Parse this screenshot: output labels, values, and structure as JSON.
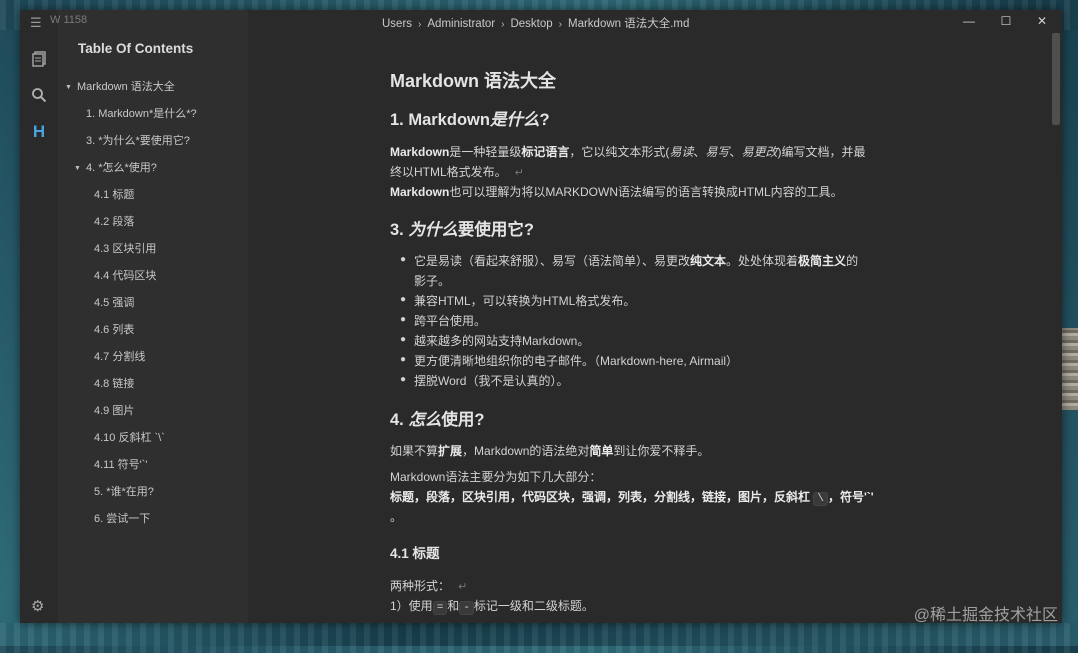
{
  "window": {
    "label": "W 1158",
    "controls": {
      "minimize": "—",
      "maximize": "☐",
      "close": "✕"
    }
  },
  "activity_bar": {
    "icons": [
      "files-icon",
      "search-icon",
      "outline-icon",
      "settings-icon"
    ],
    "outline_glyph": "H"
  },
  "sidebar": {
    "title": "Table Of Contents",
    "items": [
      {
        "label": "Markdown 语法大全",
        "caret": "▼"
      },
      {
        "label": "1. Markdown*是什么*?"
      },
      {
        "label": "3. *为什么*要使用它?"
      },
      {
        "label": "4. *怎么*使用?",
        "caret": "▼"
      },
      {
        "label": "4.1 标题"
      },
      {
        "label": "4.2 段落"
      },
      {
        "label": "4.3 区块引用"
      },
      {
        "label": "4.4 代码区块"
      },
      {
        "label": "4.5 强调"
      },
      {
        "label": "4.6 列表"
      },
      {
        "label": "4.7 分割线"
      },
      {
        "label": "4.8 链接"
      },
      {
        "label": "4.9 图片"
      },
      {
        "label": "4.10 反斜杠 `\\`"
      },
      {
        "label": "4.11 符号'`'"
      },
      {
        "label": "5. *谁*在用?"
      },
      {
        "label": "6. 尝试一下"
      }
    ]
  },
  "breadcrumb": [
    "Users",
    "Administrator",
    "Desktop",
    "Markdown 语法大全.md"
  ],
  "breadcrumb_sep": "›",
  "document": {
    "title": "Markdown 语法大全",
    "s1": {
      "prefix": "1. Markdown",
      "italic": "是什么",
      "suffix": "?"
    },
    "p1": {
      "b1": "Markdown",
      "t1": "是一种轻量级",
      "b2": "标记语言",
      "t2": "，它以纯文本形式(",
      "i1": "易读",
      "t3": "、",
      "i2": "易写",
      "t4": "、",
      "i3": "易更改",
      "t5": ")编写文档，并最",
      "line2": "终以HTML格式发布。",
      "ret": "↵"
    },
    "p2": {
      "b": "Markdown",
      "t": "也可以理解为将以MARKDOWN语法编写的语言转换成HTML内容的工具。"
    },
    "s3": {
      "prefix": "3. ",
      "italic": "为什么",
      "suffix": "要使用它?"
    },
    "list": {
      "l1a": "它是易读（看起来舒服）、易写（语法简单）、易更改",
      "l1b": "纯文本",
      "l1c": "。处处体现着",
      "l1d": "极简主义",
      "l1e": "的",
      "l1f": "影子。",
      "l2": "兼容HTML，可以转换为HTML格式发布。",
      "l3": "跨平台使用。",
      "l4": "越来越多的网站支持Markdown。",
      "l5": "更方便清晰地组织你的电子邮件。（Markdown-here, Airmail）",
      "l6": "摆脱Word（我不是认真的）。"
    },
    "s4": {
      "prefix": "4. ",
      "italic": "怎么",
      "suffix": "使用?"
    },
    "p3": {
      "t1": "如果不算",
      "b1": "扩展",
      "t2": "，Markdown的语法绝对",
      "b2": "简单",
      "t3": "到让你爱不释手。"
    },
    "p4": "Markdown语法主要分为如下几大部分：",
    "p5": {
      "a": "标题，段落，区块引用，代码区块，强调，列表，分割线，链接，图片，反斜杠 ",
      "code": "\\",
      "b": "，符号'`'",
      "c": "。"
    },
    "s41": "4.1 标题",
    "p6": {
      "t": "两种形式：",
      "ret": "↵"
    },
    "p7": {
      "a": "1）使用",
      "c1": "=",
      "b": "和",
      "c2": "-",
      "c": "标记一级和二级标题。"
    }
  },
  "watermark": "@稀土掘金技术社区",
  "icons": {
    "menu": "☰",
    "files": "🗐",
    "search": "⌕",
    "settings": "⚙"
  }
}
